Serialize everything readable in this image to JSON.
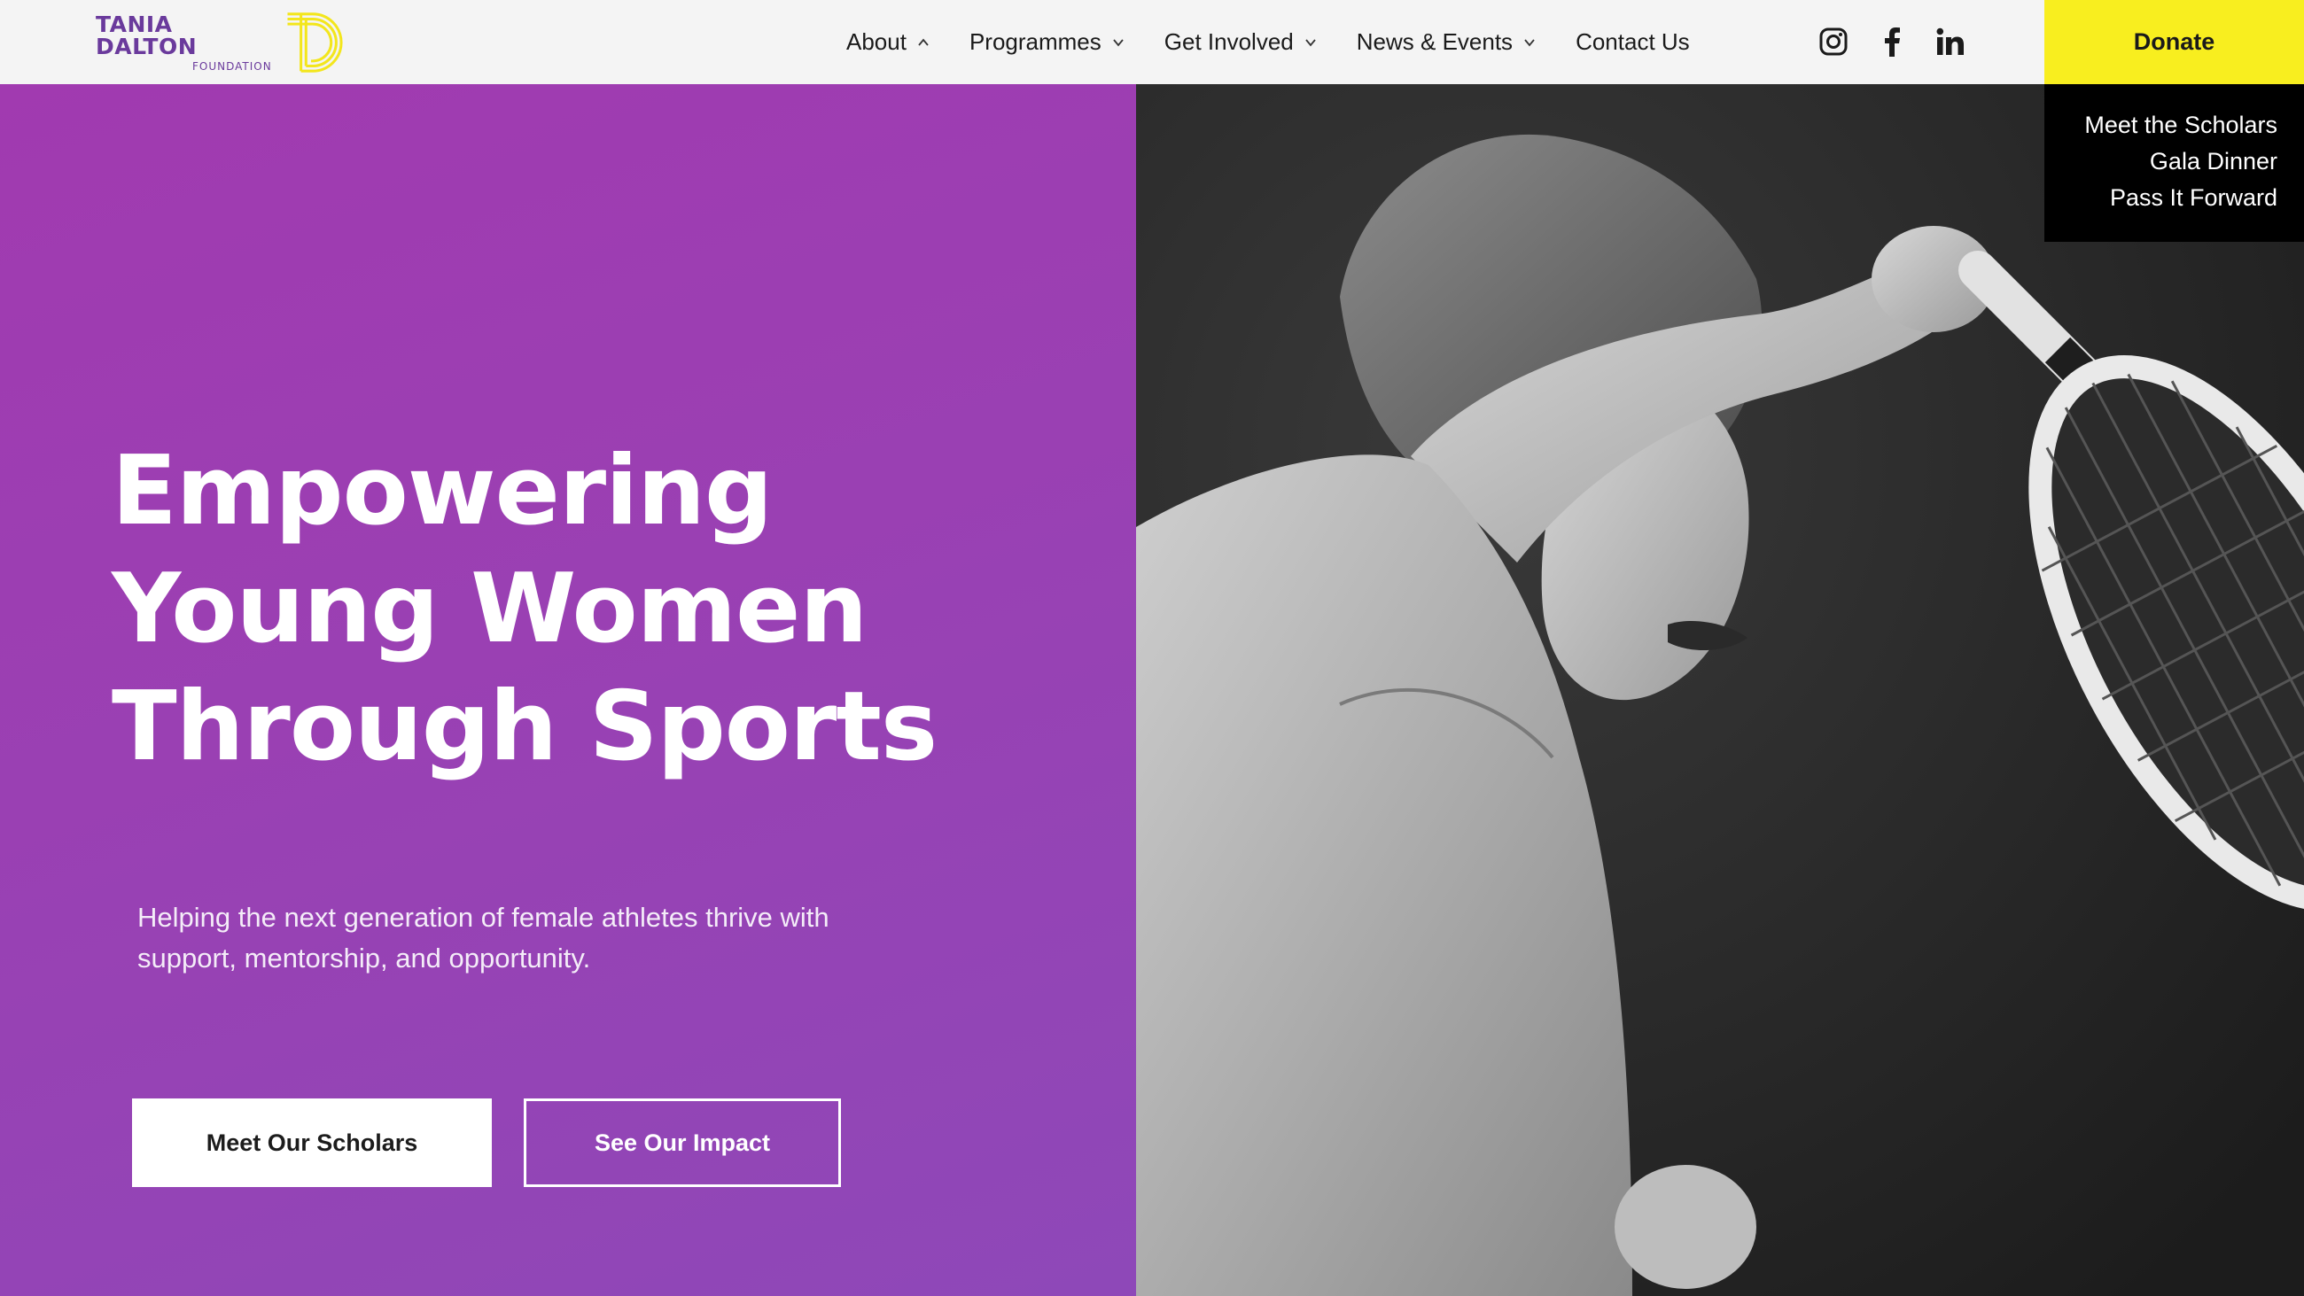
{
  "brand": {
    "name": "TANIA DALTON",
    "sub": "FOUNDATION",
    "colors": {
      "purple": "#9a40b3",
      "yellow": "#f8ee1f",
      "logo_purple": "#6a3a9c"
    }
  },
  "nav": {
    "items": [
      {
        "label": "About",
        "icon": "chevron-up-icon"
      },
      {
        "label": "Programmes",
        "icon": "chevron-down-icon"
      },
      {
        "label": "Get Involved",
        "icon": "chevron-down-icon"
      },
      {
        "label": "News & Events",
        "icon": "chevron-down-icon"
      },
      {
        "label": "Contact Us"
      }
    ],
    "socials": [
      "instagram-icon",
      "facebook-icon",
      "linkedin-icon"
    ],
    "donate_label": "Donate"
  },
  "dropdown": {
    "items": [
      "Meet the Scholars",
      "Gala Dinner",
      "Pass It Forward"
    ]
  },
  "hero": {
    "title_lines": [
      "Empowering",
      "Young Women",
      "Through Sports"
    ],
    "subtitle_line1": "Helping the next generation of female athletes thrive with",
    "subtitle_line2": "support, mentorship, and opportunity.",
    "primary_cta": "Meet Our Scholars",
    "secondary_cta": "See Our Impact"
  }
}
